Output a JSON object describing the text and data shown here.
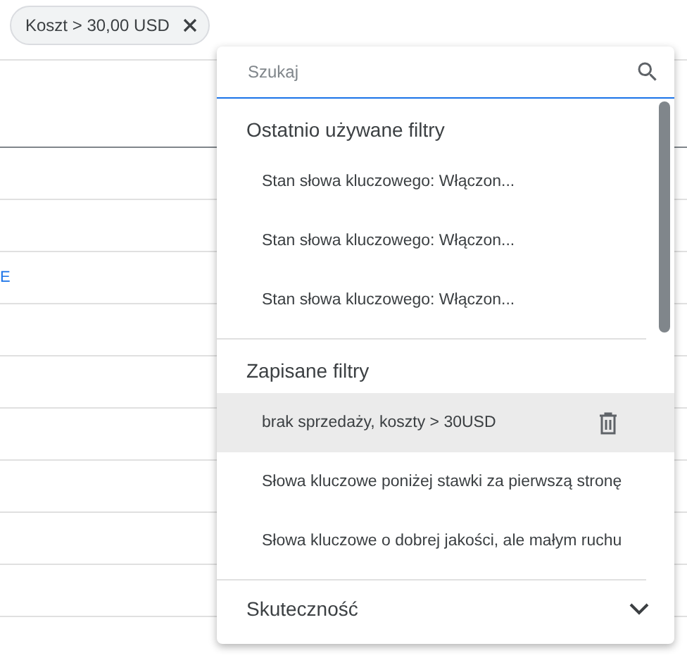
{
  "chip": {
    "label": "Koszt > 30,00 USD"
  },
  "table": {
    "rows": [
      {
        "cell": ""
      },
      {
        "cell": ""
      },
      {
        "cell": "E"
      },
      {
        "cell": ""
      },
      {
        "cell": ""
      },
      {
        "cell": ""
      },
      {
        "cell": ""
      },
      {
        "cell": ""
      },
      {
        "cell": ""
      }
    ]
  },
  "menu": {
    "search": {
      "placeholder": "Szukaj"
    },
    "sections": [
      {
        "title": "Ostatnio używane filtry",
        "kind": "list",
        "items": [
          {
            "label": "Stan słowa kluczowego: Włączon...",
            "selected": false
          },
          {
            "label": "Stan słowa kluczowego: Włączon...",
            "selected": false
          },
          {
            "label": "Stan słowa kluczowego: Włączon...",
            "selected": false
          }
        ]
      },
      {
        "title": "Zapisane filtry",
        "kind": "list",
        "items": [
          {
            "label": "brak sprzedaży, koszty > 30USD",
            "selected": true
          },
          {
            "label": "Słowa kluczowe poniżej stawki za pierwszą stronę",
            "selected": false
          },
          {
            "label": "Słowa kluczowe o dobrej jakości, ale małym ruchu",
            "selected": false
          }
        ]
      },
      {
        "title": "Skuteczność",
        "kind": "collapsed"
      }
    ]
  }
}
